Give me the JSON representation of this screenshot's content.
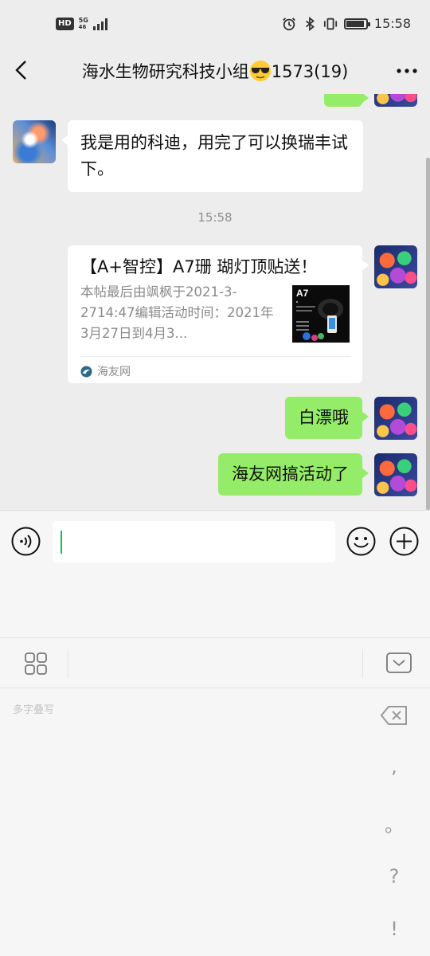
{
  "status_bar": {
    "hd": "HD",
    "network": "5G",
    "network_sub": "46",
    "time": "15:58"
  },
  "header": {
    "title": "海水生物研究科技小组",
    "title_suffix": "1573(19)",
    "title_emoji": "sunglasses-face-icon"
  },
  "messages": [
    {
      "side": "left",
      "text": "我是用的科迪，用完了可以换瑞丰试下。"
    },
    {
      "type": "timestamp",
      "text": "15:58"
    },
    {
      "side": "right",
      "type": "link_card",
      "title": "【A+智控】A7珊 瑚灯顶贴送！",
      "description": "本帖最后由飒枫于2021-3-2714:47编辑活动时间：2021年3月27日到4月3...",
      "thumb_label": "A7",
      "source": "海友网"
    },
    {
      "side": "right",
      "text": "白漂哦"
    },
    {
      "side": "right",
      "text": "海友网搞活动了"
    }
  ],
  "input": {
    "value": "",
    "placeholder": ""
  },
  "keyboard": {
    "hint": "多字叠写",
    "symbols": [
      ",",
      "。",
      "?",
      "!"
    ]
  },
  "colors": {
    "accent": "#07c160",
    "bubble_self": "#95ec69",
    "bubble_other": "#ffffff",
    "background": "#ededed"
  }
}
